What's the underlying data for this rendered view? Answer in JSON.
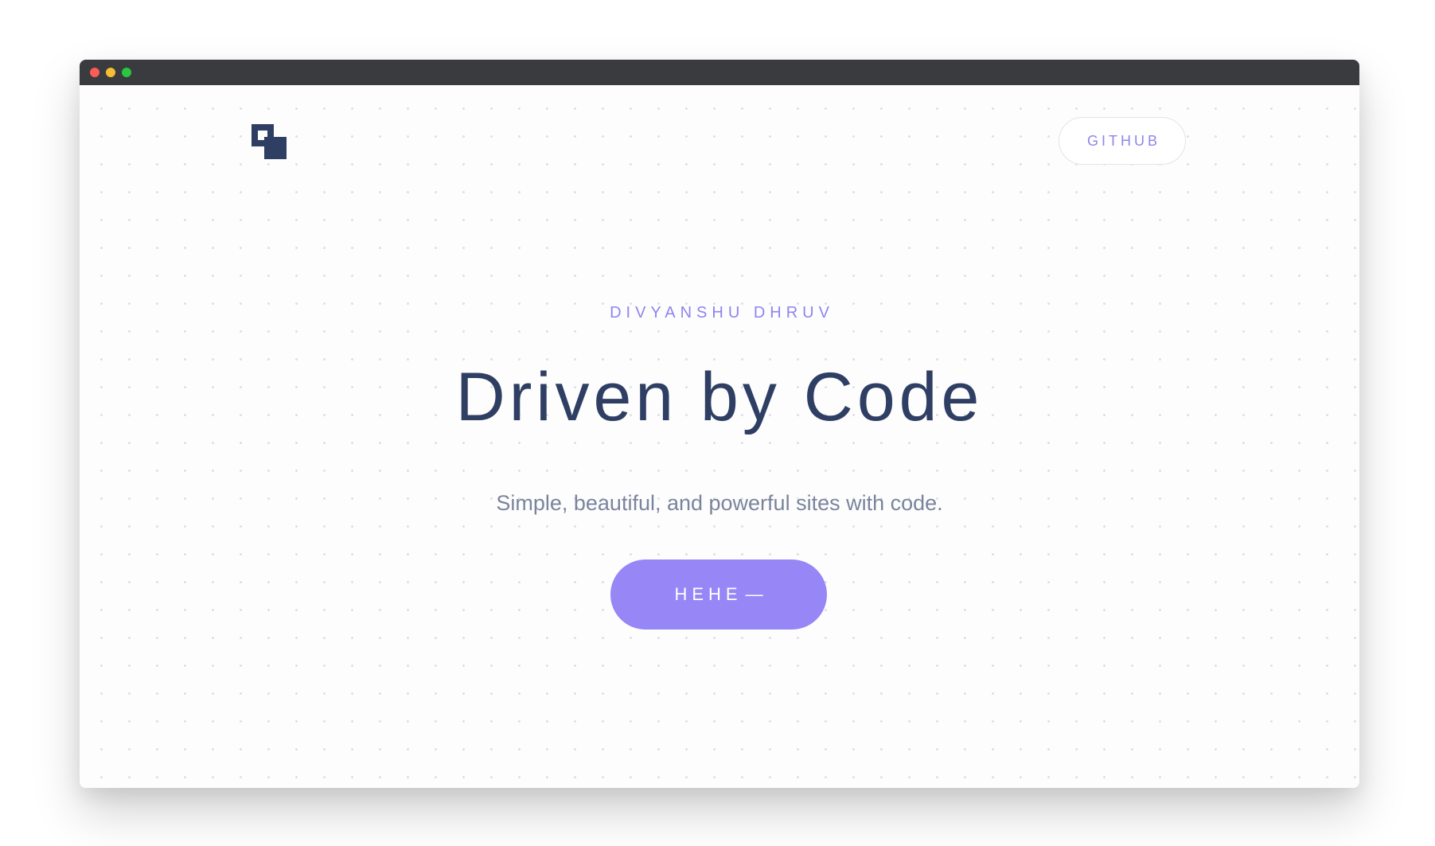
{
  "brand": {
    "logo_icon": "overlapping-squares-logo-icon",
    "color": "#2f3e63"
  },
  "nav": {
    "github_label": "GITHUB"
  },
  "hero": {
    "eyebrow": "DIVYANSHU DHRUV",
    "title": "Driven by Code",
    "subtitle": "Simple, beautiful, and powerful sites with code.",
    "cta_label": "HEHE",
    "cta_arrow": "—"
  },
  "colors": {
    "accent": "#9686f6",
    "accent_text": "#8f84ef",
    "heading": "#2f3e63",
    "body_text": "#7a849c",
    "titlebar": "#3a3b3e"
  },
  "window_controls": [
    "close-icon",
    "minimize-icon",
    "maximize-icon"
  ]
}
